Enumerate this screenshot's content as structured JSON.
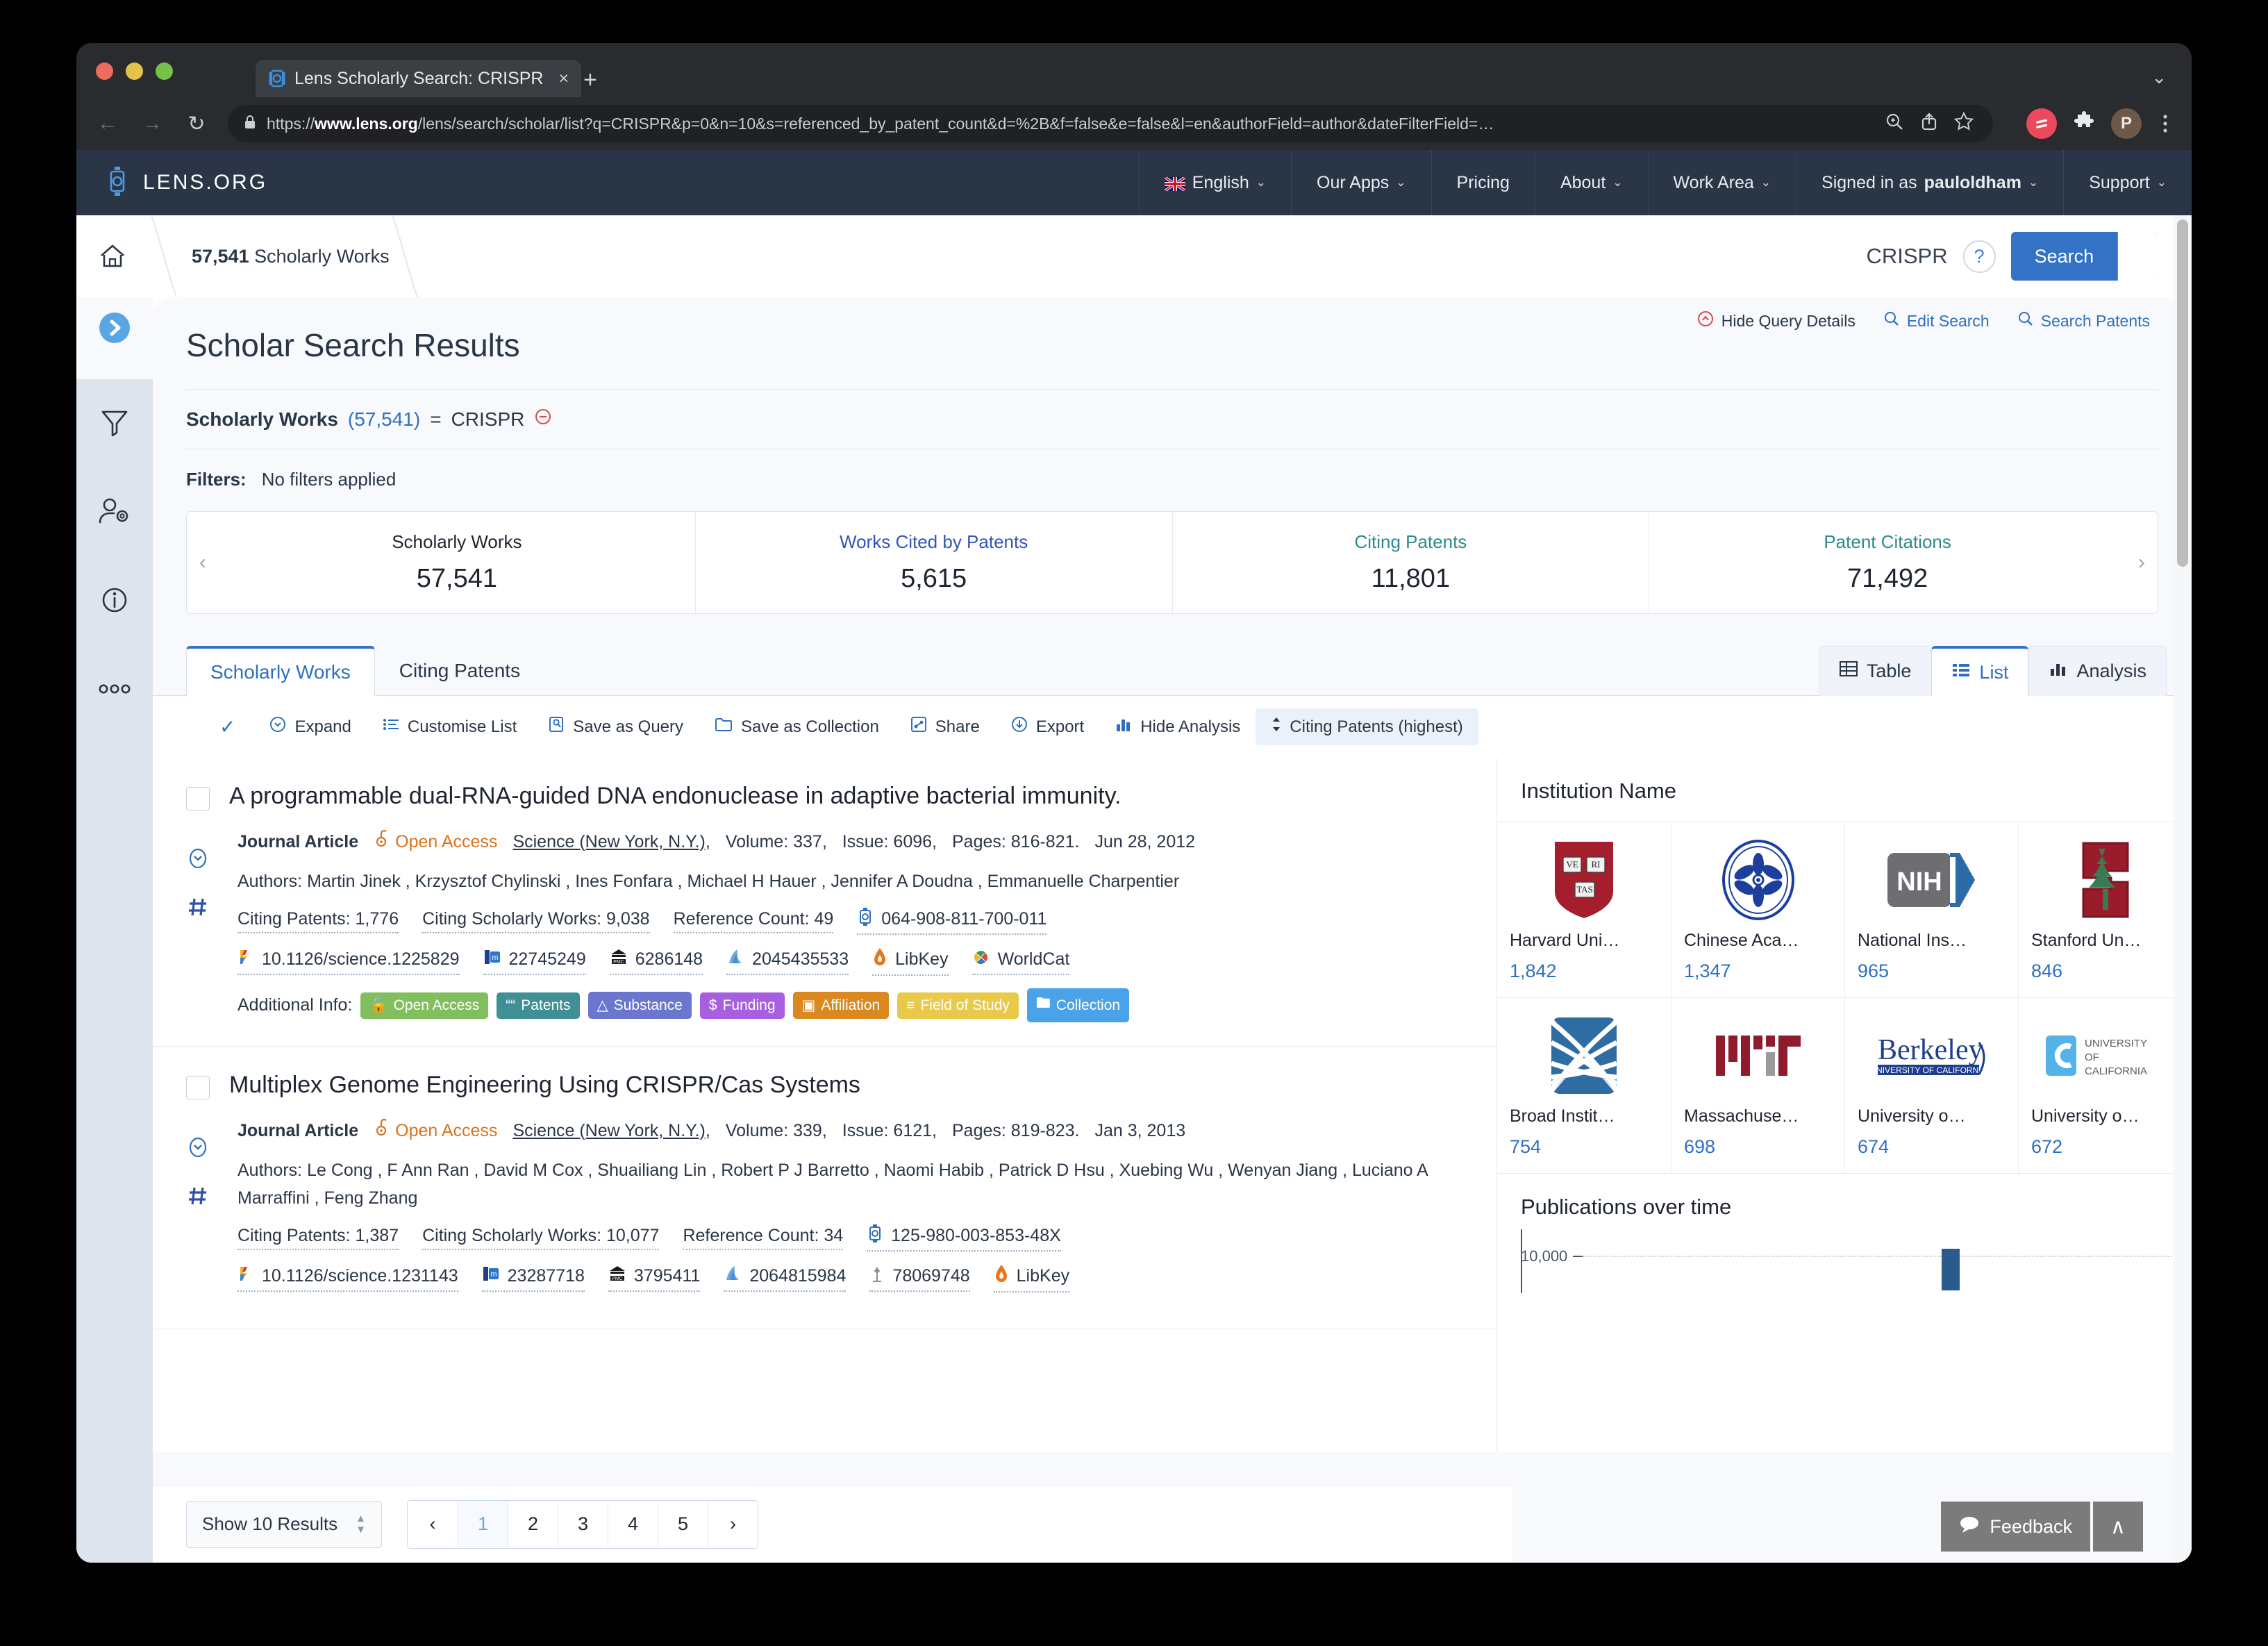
{
  "browser": {
    "tab_title": "Lens Scholarly Search: CRISPR",
    "tab_close": "×",
    "new_tab": "+",
    "tab_list_chevron": "⌄",
    "url_prefix": "https://",
    "url_domain": "www.lens.org",
    "url_rest": "/lens/search/scholar/list?q=CRISPR&p=0&n=10&s=referenced_by_patent_count&d=%2B&f=false&e=false&l=en&authorField=author&dateFilterField=…",
    "profile_initial": "P",
    "back": "←",
    "forward": "→",
    "reload": "↻"
  },
  "topnav": {
    "brand": "LENS.ORG",
    "items": [
      {
        "label": "English",
        "icon": "uk-flag-icon",
        "caret": "⌄"
      },
      {
        "label": "Our Apps",
        "caret": "⌄"
      },
      {
        "label": "Pricing",
        "caret": ""
      },
      {
        "label": "About",
        "caret": "⌄"
      },
      {
        "label": "Work Area",
        "caret": "⌄"
      },
      {
        "label": "Signed in as ",
        "strong": "pauloldham",
        "caret": "⌄"
      },
      {
        "label": "Support",
        "caret": "⌄"
      }
    ]
  },
  "searchbar": {
    "breadcrumb_count": "57,541",
    "breadcrumb_label": " Scholarly Works",
    "query": "CRISPR",
    "help": "?",
    "search_label": "Search",
    "search_caret": "▼"
  },
  "rail": {
    "expand_icon": "chevron-right-circle-icon",
    "items": [
      "filter-icon",
      "user-settings-icon",
      "info-icon",
      "more-icon"
    ]
  },
  "page": {
    "title": "Scholar Search Results",
    "query_actions": [
      {
        "label": "Hide Query Details",
        "icon": "hide-icon"
      },
      {
        "label": "Edit Search",
        "icon": "search-icon"
      },
      {
        "label": "Search Patents",
        "icon": "search-icon"
      }
    ],
    "query_summary": {
      "field": "Scholarly Works",
      "count": "(57,541)",
      "operator": "=",
      "value": "CRISPR",
      "remove_icon": "remove-circle-icon"
    },
    "filters_label": "Filters:",
    "filters_value": "No filters applied"
  },
  "stats": {
    "prev": "‹",
    "next": "›",
    "cells": [
      {
        "header": "Scholarly Works",
        "value": "57,541",
        "color": "#1d2430"
      },
      {
        "header": "Works Cited by Patents",
        "value": "5,615",
        "color": "#3355bb"
      },
      {
        "header": "Citing Patents",
        "value": "11,801",
        "color": "#2d8a8a"
      },
      {
        "header": "Patent Citations",
        "value": "71,492",
        "color": "#2d8a8a"
      }
    ]
  },
  "tabs": {
    "primary": [
      {
        "label": "Scholarly Works",
        "active": true
      },
      {
        "label": "Citing Patents",
        "active": false
      }
    ],
    "views": [
      {
        "label": "Table",
        "icon": "table-icon",
        "active": false
      },
      {
        "label": "List",
        "icon": "list-icon",
        "active": true
      },
      {
        "label": "Analysis",
        "icon": "chart-icon",
        "active": false
      }
    ]
  },
  "toolbar": {
    "check": "✓",
    "items": [
      {
        "label": "Expand",
        "icon": "chevron-down-circle-icon"
      },
      {
        "label": "Customise List",
        "icon": "list-settings-icon"
      },
      {
        "label": "Save as Query",
        "icon": "save-query-icon"
      },
      {
        "label": "Save as Collection",
        "icon": "folder-icon"
      },
      {
        "label": "Share",
        "icon": "share-icon"
      },
      {
        "label": "Export",
        "icon": "export-icon"
      },
      {
        "label": "Hide Analysis",
        "icon": "chart-icon"
      },
      {
        "label": "Citing Patents (highest)",
        "icon": "sort-icon",
        "pill": true
      }
    ]
  },
  "results": [
    {
      "title": "A programmable dual-RNA-guided DNA endonuclease in adaptive bacterial immunity.",
      "type": "Journal Article",
      "open_access": "Open Access",
      "journal": "Science (New York, N.Y.),",
      "volume": "Volume: 337,",
      "issue": "Issue: 6096,",
      "pages": "Pages: 816-821.",
      "date": "Jun 28, 2012",
      "authors_label": "Authors:",
      "authors": "Martin Jinek , Krzysztof Chylinski , Ines Fonfara , Michael H Hauer , Jennifer A Doudna , Emmanuelle Charpentier",
      "metrics": [
        {
          "label": "Citing Patents: 1,776"
        },
        {
          "label": "Citing Scholarly Works: 9,038"
        },
        {
          "label": "Reference Count: 49"
        },
        {
          "label": "064-908-811-700-011",
          "icon": "lens-id-icon"
        }
      ],
      "identifiers": [
        {
          "label": "10.1126/science.1225829",
          "icon": "doi-icon"
        },
        {
          "label": "22745249",
          "icon": "pubmed-icon"
        },
        {
          "label": "6286148",
          "icon": "pmc-icon"
        },
        {
          "label": "2045435533",
          "icon": "mag-icon"
        },
        {
          "label": "LibKey",
          "icon": "libkey-icon"
        },
        {
          "label": "WorldCat",
          "icon": "worldcat-icon"
        }
      ],
      "additional_label": "Additional Info:",
      "badges": [
        {
          "label": "Open Access",
          "color": "#81bf5e",
          "icon": "unlock-icon"
        },
        {
          "label": "Patents",
          "color": "#3f8f95",
          "icon": "quotes-icon"
        },
        {
          "label": "Substance",
          "color": "#6b77cf",
          "icon": "flask-icon"
        },
        {
          "label": "Funding",
          "color": "#a75ee0",
          "icon": "dollar-icon"
        },
        {
          "label": "Affiliation",
          "color": "#d98920",
          "icon": "id-card-icon"
        },
        {
          "label": "Field of Study",
          "color": "#e8c94a",
          "icon": "checklist-icon"
        },
        {
          "label": "Collection",
          "color": "#4aa3e8",
          "icon": "folder-open-icon"
        }
      ]
    },
    {
      "title": "Multiplex Genome Engineering Using CRISPR/Cas Systems",
      "type": "Journal Article",
      "open_access": "Open Access",
      "journal": "Science (New York, N.Y.),",
      "volume": "Volume: 339,",
      "issue": "Issue: 6121,",
      "pages": "Pages: 819-823.",
      "date": "Jan 3, 2013",
      "authors_label": "Authors:",
      "authors": "Le Cong , F Ann Ran , David M Cox , Shuailiang Lin , Robert P J Barretto , Naomi Habib , Patrick D Hsu , Xuebing Wu , Wenyan Jiang , Luciano A Marraffini , Feng Zhang",
      "metrics": [
        {
          "label": "Citing Patents: 1,387"
        },
        {
          "label": "Citing Scholarly Works: 10,077"
        },
        {
          "label": "Reference Count: 34"
        },
        {
          "label": "125-980-003-853-48X",
          "icon": "lens-id-icon"
        }
      ],
      "identifiers": [
        {
          "label": "10.1126/science.1231143",
          "icon": "doi-icon"
        },
        {
          "label": "23287718",
          "icon": "pubmed-icon"
        },
        {
          "label": "3795411",
          "icon": "pmc-icon"
        },
        {
          "label": "2064815984",
          "icon": "mag-icon"
        },
        {
          "label": "78069748",
          "icon": "core-icon"
        },
        {
          "label": "LibKey",
          "icon": "libkey-icon"
        }
      ],
      "additional_label": "",
      "badges": []
    }
  ],
  "sidepanel": {
    "institution_title": "Institution Name",
    "institutions": [
      {
        "name": "Harvard Uni…",
        "value": "1,842",
        "logo": "harvard-logo"
      },
      {
        "name": "Chinese Aca…",
        "value": "1,347",
        "logo": "cas-logo"
      },
      {
        "name": "National Ins…",
        "value": "965",
        "logo": "nih-logo"
      },
      {
        "name": "Stanford Un…",
        "value": "846",
        "logo": "stanford-logo"
      },
      {
        "name": "Broad Instit…",
        "value": "754",
        "logo": "broad-logo"
      },
      {
        "name": "Massachuse…",
        "value": "698",
        "logo": "mit-logo"
      },
      {
        "name": "University o…",
        "value": "674",
        "logo": "berkeley-logo"
      },
      {
        "name": "University o…",
        "value": "672",
        "logo": "uc-logo"
      }
    ],
    "chart_title": "Publications over time",
    "chart_ytick": "10,000"
  },
  "chart_data": {
    "type": "bar",
    "title": "Publications over time",
    "xlabel": "",
    "ylabel": "",
    "ylim": [
      0,
      10000
    ],
    "yticks": [
      10000
    ],
    "categories": [],
    "values": [],
    "grid": true,
    "note": "Chart is cut off at the bottom of the viewport; only the 10,000 gridline and one partial bar are visible."
  },
  "pagination": {
    "show_label": "Show 10 Results",
    "prev": "‹",
    "next": "›",
    "pages": [
      "1",
      "2",
      "3",
      "4",
      "5"
    ],
    "current": "1"
  },
  "overlay": {
    "feedback": "Feedback",
    "to_top": "∧"
  }
}
